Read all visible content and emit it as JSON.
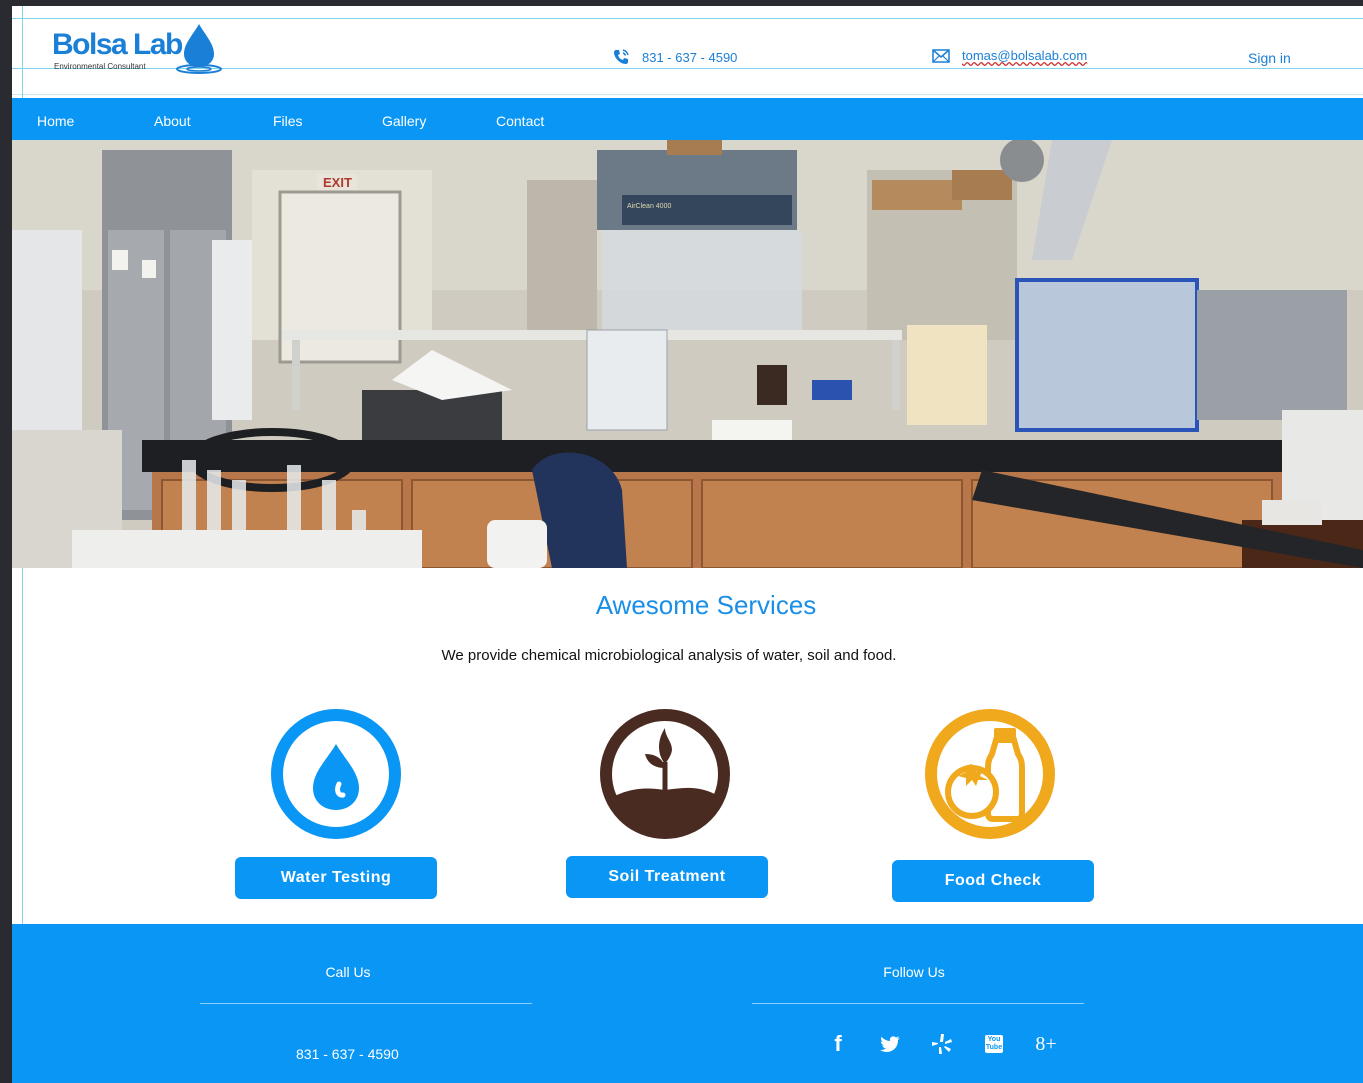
{
  "header": {
    "logo_name": "Bolsa Lab",
    "logo_tagline": "Environmental Consultant",
    "phone": "831 - 637 - 4590",
    "email": "tomas@bolsalab.com",
    "signin_label": "Sign in",
    "phone_icon": "phone-icon",
    "email_icon": "envelope-icon"
  },
  "nav": {
    "items": [
      {
        "label": "Home"
      },
      {
        "label": "About"
      },
      {
        "label": "Files"
      },
      {
        "label": "Gallery"
      },
      {
        "label": "Contact"
      }
    ]
  },
  "hero": {
    "exit_sign": "EXIT",
    "hood_label": "AirClean 4000"
  },
  "services": {
    "title": "Awesome Services",
    "description": "We provide chemical microbiological analysis of water, soil and food.",
    "items": [
      {
        "label": "Water Testing",
        "icon": "water-drop-icon",
        "color": "#0a96f5"
      },
      {
        "label": "Soil Treatment",
        "icon": "sprout-icon",
        "color": "#4a2b22"
      },
      {
        "label": "Food Check",
        "icon": "food-icon",
        "color": "#f0a81c"
      }
    ]
  },
  "footer": {
    "call_heading": "Call Us",
    "follow_heading": "Follow Us",
    "phone": "831 - 637 - 4590",
    "social": [
      {
        "icon": "facebook-icon",
        "glyph": "f"
      },
      {
        "icon": "twitter-icon",
        "glyph": ""
      },
      {
        "icon": "yelp-icon",
        "glyph": ""
      },
      {
        "icon": "youtube-icon",
        "glyph": "You Tube"
      },
      {
        "icon": "google-plus-icon",
        "glyph": "8+"
      }
    ]
  },
  "colors": {
    "brand_blue": "#0a96f5",
    "title_blue": "#1a8fe8",
    "soil_brown": "#4a2b22",
    "food_orange": "#f0a81c"
  }
}
